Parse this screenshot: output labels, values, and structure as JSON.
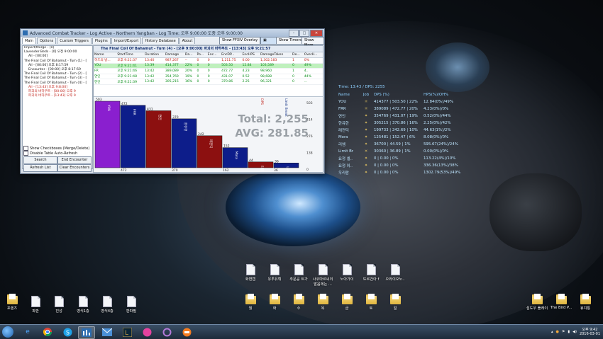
{
  "act": {
    "title": "Advanced Combat Tracker - Log Active - Northern Yangban - Log Time: 오후 9:00:00 도중 오후 9:00:00",
    "tabs": [
      "Main",
      "Options",
      "Custom Triggers",
      "Plugins",
      "Import/Export",
      "History Database",
      "About"
    ],
    "buttons": {
      "overlay": "Show FFXIV Overlay",
      "timers": "Show Timers",
      "more": "Show More"
    },
    "tree": [
      {
        "text": "Import/Merge - [0]",
        "red": false
      },
      {
        "text": "Lavender Beds - [0] 오전 9:00:00",
        "red": false
      },
      {
        "text": "All - [00:00]",
        "red": false
      },
      {
        "text": "The Final Coil Of Bahamut - Turn (1) - [",
        "red": false
      },
      {
        "text": "All - [00:00] 오후 8:17:59",
        "red": false
      },
      {
        "text": "Encounter - [00:00] 오후 8:17:59",
        "red": false
      },
      {
        "text": "The Final Coil Of Bahamut - Turn (2) - [",
        "red": false
      },
      {
        "text": "The Final Coil Of Bahamut - Turn (3) - [",
        "red": false
      },
      {
        "text": "The Final Coil Of Bahamut - Turn (4) - [",
        "red": false
      },
      {
        "text": "All - [13:43] 오후 9:8:00]",
        "red": true
      },
      {
        "text": "파괴의 바하무트 - [00:00] 오후 9",
        "red": true
      },
      {
        "text": "파괴의 바하무트 - [13:43] 오후 9",
        "red": true
      }
    ],
    "checkboxes": [
      "Show Checkboxes (Merge/Delete)",
      "Disable Table Auto-Refresh"
    ],
    "side_buttons": [
      "Search",
      "End Encounter",
      "Refresh List",
      "Clear Encounters"
    ],
    "encounter_title": "The Final Coil Of Bahamut - Turn (4) - [오후 9:00:00] 파괴의 바하무트 - [13:43] 오후 9:21:57",
    "columns": [
      "Name",
      "StartTime",
      "Duration",
      "Damage",
      "Da...",
      "Po...",
      "Enc...",
      "EncDP...",
      "EncHPS",
      "DamageTaken",
      "De...",
      "OverH..."
    ],
    "rows": [
      {
        "cells": [
          "허드의 방...",
          "오후 9:21:37",
          "13:40",
          "987,267",
          "--",
          "0",
          "0",
          "1,211.75",
          "0.00",
          "1,302,183",
          "1",
          "0%"
        ],
        "color": "#c0231b",
        "sel": false
      },
      {
        "cells": [
          "YOU",
          "오후 9:21:41",
          "13:39",
          "414,377",
          "22%",
          "0",
          "0",
          "503.50",
          "12.84",
          "103,589",
          "0",
          "49%"
        ],
        "color": "#0a8f1a",
        "sel": true
      },
      {
        "cells": [
          "FR",
          "오후 9:21:46",
          "13:42",
          "389,089",
          "20%",
          "0",
          "0",
          "472.77",
          "4.23",
          "98,960",
          "1",
          "4.."
        ],
        "color": "#0a8f1a",
        "sel": false
      },
      {
        "cells": [
          "연인",
          "오후 9:21:48",
          "13:42",
          "354,769",
          "19%",
          "0",
          "0",
          "431.07",
          "0.52",
          "98,688",
          "0",
          "44%"
        ],
        "color": "#0a8f1a",
        "sel": false
      },
      {
        "cells": [
          "연인",
          "오후 9:21:39",
          "13:42",
          "305,215",
          "16%",
          "0",
          "0",
          "370.86",
          "2.25",
          "96,321",
          "0",
          "..."
        ],
        "color": "#0a8f1a",
        "sel": false
      }
    ],
    "chart_data": {
      "type": "bar",
      "categories": [
        "YOU",
        "FRR",
        "연인",
        "한유한",
        "레전딕",
        "Mora",
        "리엠",
        "Limit Br"
      ],
      "values": [
        503,
        472,
        431,
        370,
        242,
        152,
        44,
        36
      ],
      "colors": [
        "#8a1fcf",
        "#0d1d8a",
        "#8c1010",
        "#0d1d8a",
        "#8c1010",
        "#0d1d8a",
        "#8c1010",
        "#0d1d8a"
      ],
      "axis_labels": [
        "503",
        "472",
        "431",
        "370",
        "242",
        "152",
        "44",
        "36"
      ],
      "axis_right": [
        "503",
        "414",
        "276",
        "138",
        "0"
      ],
      "extra_top_labels": [
        "DPS",
        "Limit Break"
      ],
      "x_ticks": [
        "472",
        "370",
        "162",
        "36"
      ],
      "total_label": "Total: 2,255",
      "avg_label": "AVG: 281.85"
    }
  },
  "overlay": {
    "time_line": "Time: 13:43 / DPS: 2255",
    "headers": {
      "name": "Name",
      "job": "Job",
      "dps": "DPS (%)",
      "hps": "HPS(%)/OH%"
    },
    "rows": [
      {
        "name": "YOU",
        "job": "☼",
        "dps": "414377 | 503.50 | 22%",
        "hps": "12.84(0%)/49%"
      },
      {
        "name": "FRR",
        "job": "☼",
        "dps": "389089 | 472.77 | 20%",
        "hps": "4.23(0%)/0%"
      },
      {
        "name": "연인",
        "job": "✦",
        "dps": "354769 | 431.07 | 19%",
        "hps": "0.52(0%)/44%"
      },
      {
        "name": "한유한",
        "job": "✦",
        "dps": "305215 | 370.86 | 16%",
        "hps": "2.25(0%)/42%"
      },
      {
        "name": "레전딕",
        "job": "✦",
        "dps": "199733 | 242.69 | 10%",
        "hps": "44.63(1%)/2%"
      },
      {
        "name": "Mora",
        "job": "✦",
        "dps": "125481 | 152.47 | 6%",
        "hps": "8.08(0%)/0%"
      },
      {
        "name": "리엠",
        "job": "✦",
        "dps": "36700 | 44.59 | 1%",
        "hps": "595.67(24%)/24%"
      },
      {
        "name": "Limit Br",
        "job": "✕",
        "dps": "30360 | 36.89 | 1%",
        "hps": "0.00(0%)/0%"
      },
      {
        "name": "요정 셀..",
        "job": "✦",
        "dps": "0 | 0.00 | 0%",
        "hps": "113.22(4%)/10%"
      },
      {
        "name": "요정 이..",
        "job": "✦",
        "dps": "0 | 0.00 | 0%",
        "hps": "336.36(13%)/38%"
      },
      {
        "name": "우리람",
        "job": "✦",
        "dps": "0 | 0.00 | 0%",
        "hps": "1302.79(53%)/49%"
      }
    ]
  },
  "desktop": {
    "docs_top": [
      "화면캡",
      "유투유튀",
      "주문공 트가",
      "사쿠마르씨의 발음에는 ...",
      "노아가이",
      "또르건아 f",
      "오와이오노.."
    ],
    "folders_mid": [
      "월",
      "화",
      "수",
      "목",
      "금",
      "토",
      "일"
    ],
    "left_icons": [
      {
        "label": "포렌즈",
        "kind": "folder"
      },
      {
        "label": "파판",
        "kind": "doc"
      },
      {
        "label": "진성",
        "kind": "doc"
      },
      {
        "label": "영식1층",
        "kind": "doc"
      },
      {
        "label": "영식4층",
        "kind": "doc"
      },
      {
        "label": "판파필",
        "kind": "doc"
      }
    ],
    "right_icons": [
      {
        "label": "섬도우 플레이",
        "kind": "folder"
      },
      {
        "label": "The Bird P...",
        "kind": "folder"
      },
      {
        "label": "휴지통",
        "kind": "folder"
      }
    ]
  },
  "taskbar": {
    "apps": [
      "ie-icon",
      "chrome-icon",
      "skype-icon",
      "act-icon",
      "lol-icon",
      "maple-icon",
      "ring-icon",
      "kakao-icon"
    ],
    "time": "오후 9:42",
    "date": "2016-03-01"
  }
}
